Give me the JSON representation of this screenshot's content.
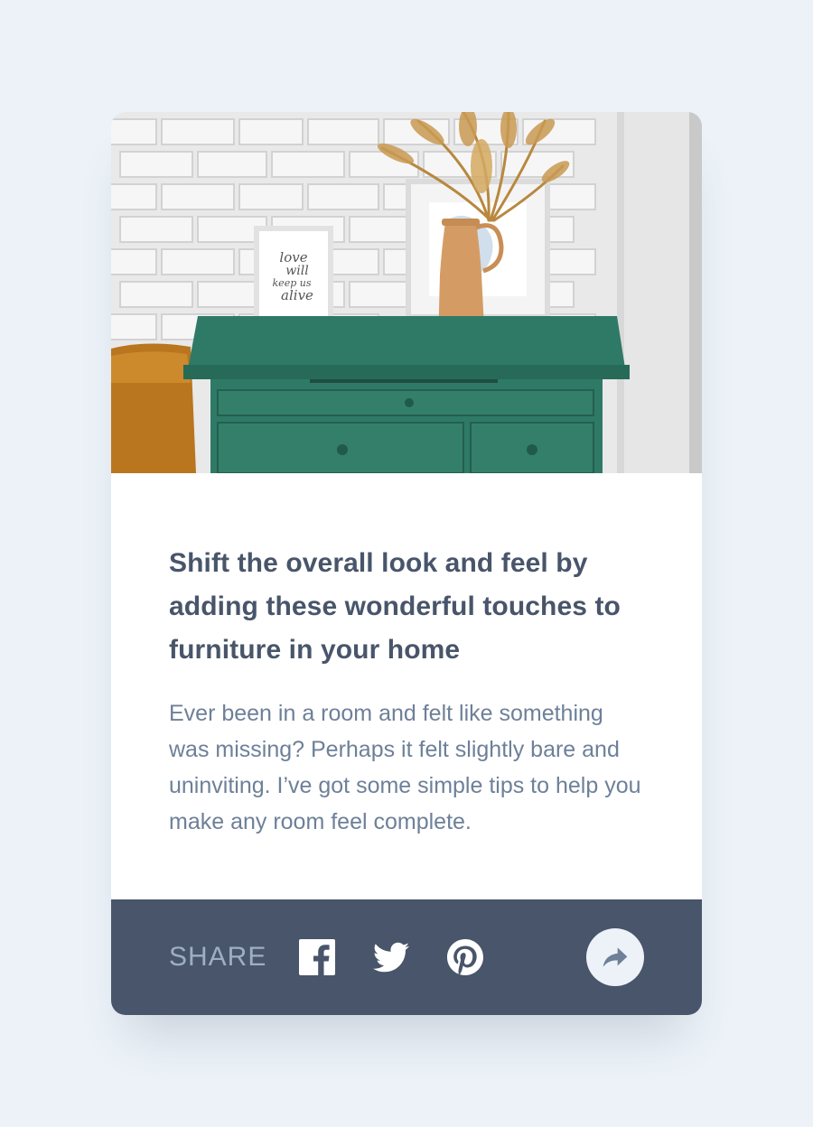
{
  "card": {
    "image_alt": "Green drawer with decorative vase and framed print on top against a white brick wall",
    "title": "Shift the overall look and feel by adding these wonderful touches to furniture in your home",
    "description": "Ever been in a room and felt like something was missing? Perhaps it felt slightly bare and uninviting. I’ve got some simple tips to help you make any room feel complete."
  },
  "share": {
    "label": "SHARE",
    "icons": [
      "facebook-icon",
      "twitter-icon",
      "pinterest-icon",
      "share-arrow-icon"
    ]
  },
  "colors": {
    "background": "#ecf2f8",
    "card": "#ffffff",
    "share_bar": "#48556a",
    "title": "#48556a",
    "body_text": "#6e8098",
    "share_label": "#9eafc2",
    "dresser_green": "#2e7a66",
    "vase": "#d4a06c"
  }
}
